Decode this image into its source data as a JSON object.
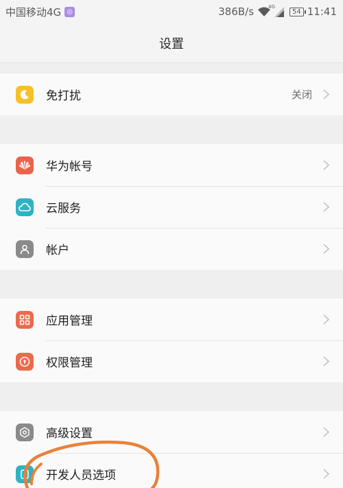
{
  "status_bar": {
    "carrier": "中国移动4G",
    "app_badge": "◎",
    "net_speed": "386B/s",
    "signal_tag": "4G",
    "battery": "54",
    "time": "11:41"
  },
  "header": {
    "title": "设置"
  },
  "groups": [
    {
      "items": [
        {
          "label": "免打扰",
          "value": "关闭",
          "icon": "moon-icon",
          "color": "#f5c02a"
        }
      ]
    },
    {
      "items": [
        {
          "label": "华为帐号",
          "icon": "huawei-icon",
          "color": "#e9634c"
        },
        {
          "label": "云服务",
          "icon": "cloud-icon",
          "color": "#2fb3c2"
        },
        {
          "label": "帐户",
          "icon": "person-icon",
          "color": "#8a8a8a"
        }
      ]
    },
    {
      "items": [
        {
          "label": "应用管理",
          "icon": "grid-icon",
          "color": "#ec6a4e"
        },
        {
          "label": "权限管理",
          "icon": "lock-icon",
          "color": "#ec6a4e"
        }
      ]
    },
    {
      "items": [
        {
          "label": "高级设置",
          "icon": "gear-icon",
          "color": "#8a8a8a"
        },
        {
          "label": "开发人员选项",
          "icon": "developer-icon",
          "color": "#2fb3c2"
        }
      ]
    }
  ],
  "annotation": {
    "color": "#e8823a"
  }
}
